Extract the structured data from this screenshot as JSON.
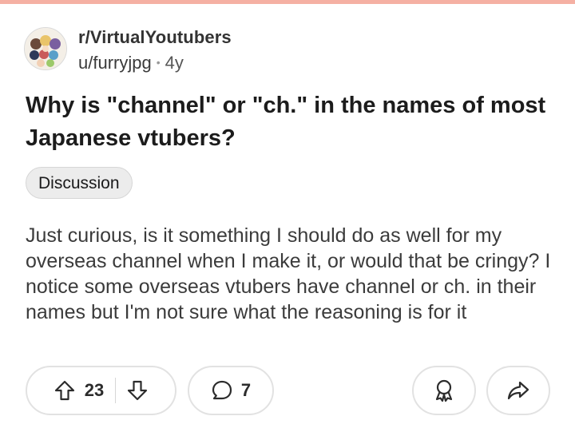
{
  "post": {
    "subreddit": "r/VirtualYoutubers",
    "author": "u/furryjpg",
    "separator": "•",
    "age": "4y",
    "title": "Why is \"channel\" or \"ch.\" in the names of most Japanese vtubers?",
    "flair": "Discussion",
    "body": "Just curious, is it something I should do as well for my overseas channel when I make it, or would that be cringy? I notice some overseas vtubers have channel or ch. in their names but I'm not sure what the reasoning is for it"
  },
  "actions": {
    "upvote_count": "23",
    "comment_count": "7"
  },
  "colors": {
    "top_accent": "#f5b0a3",
    "flair_bg": "#ececec",
    "pill_border": "#e2e2e2"
  },
  "icons": [
    "subreddit-avatar",
    "upvote-icon",
    "downvote-icon",
    "comment-icon",
    "award-icon",
    "share-icon"
  ]
}
